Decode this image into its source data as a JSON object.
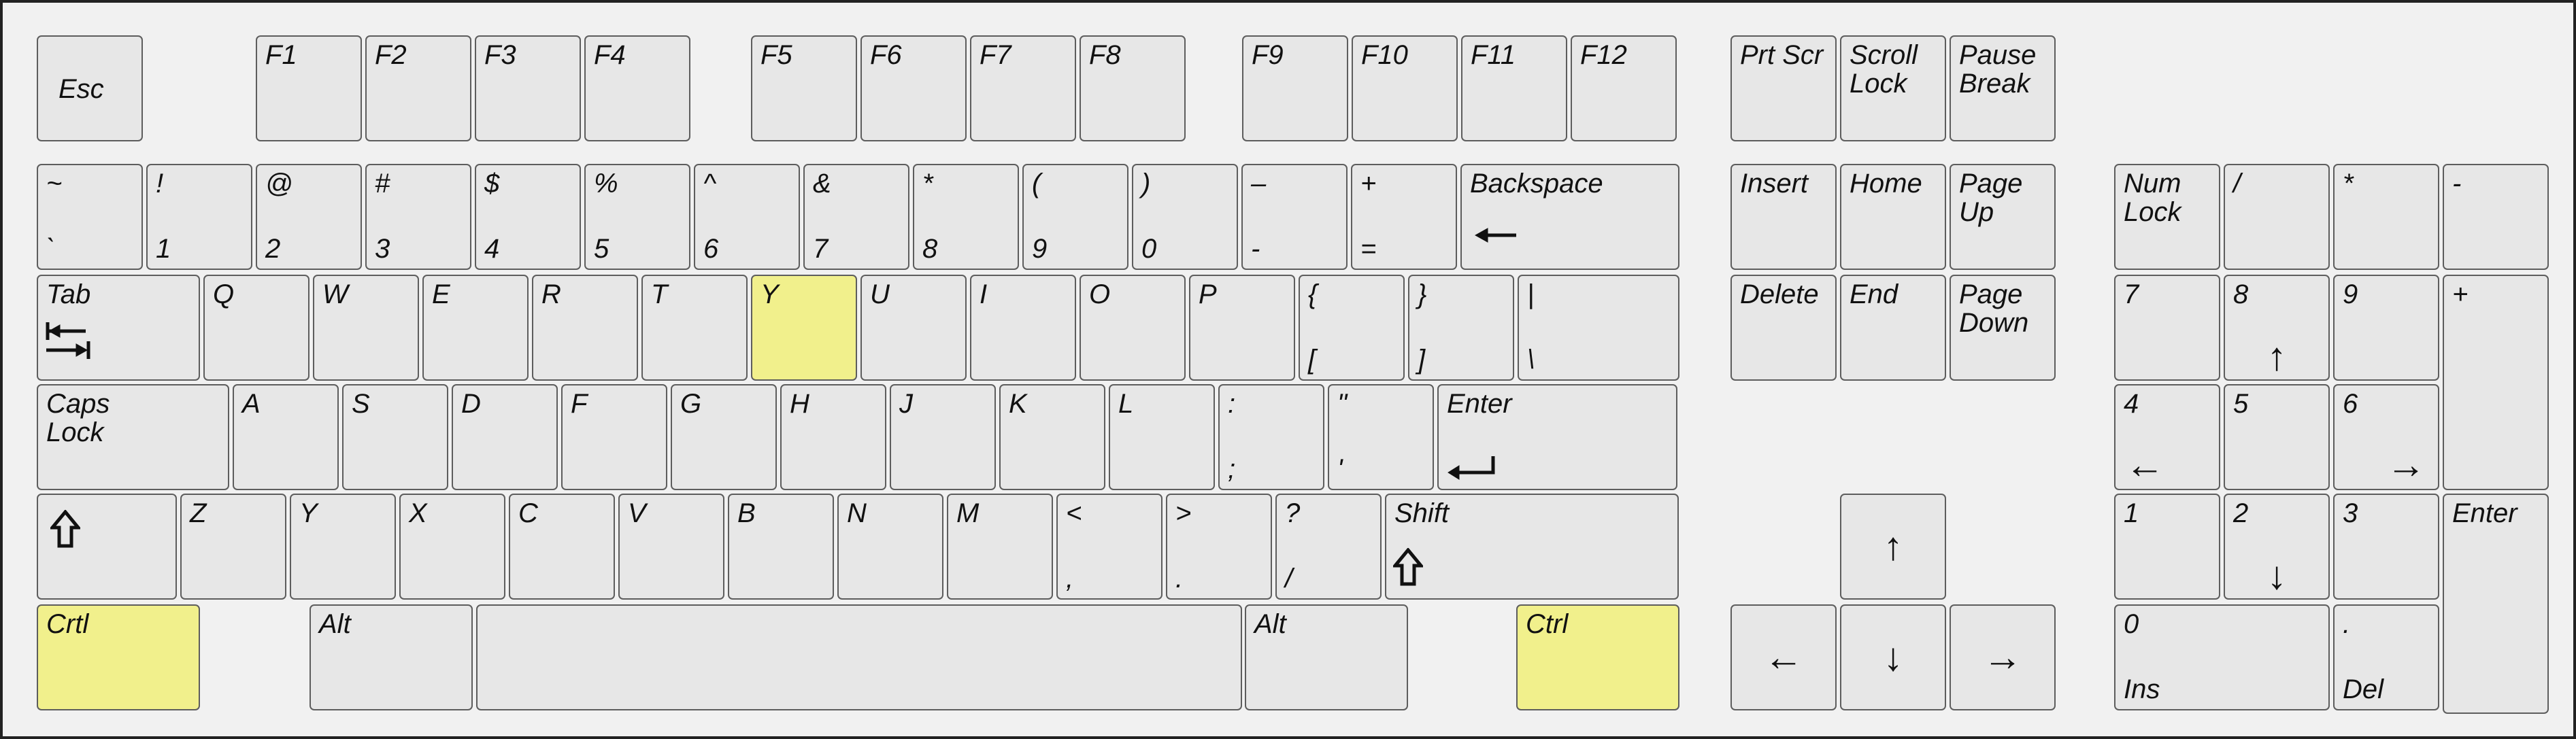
{
  "keyboard": {
    "highlight_color": "#f1f08c",
    "key_color": "#e7e7e7",
    "function_row": [
      {
        "name": "key-esc",
        "top": "Esc"
      },
      {
        "name": "key-f1",
        "top": "F1"
      },
      {
        "name": "key-f2",
        "top": "F2"
      },
      {
        "name": "key-f3",
        "top": "F3"
      },
      {
        "name": "key-f4",
        "top": "F4"
      },
      {
        "name": "key-f5",
        "top": "F5"
      },
      {
        "name": "key-f6",
        "top": "F6"
      },
      {
        "name": "key-f7",
        "top": "F7"
      },
      {
        "name": "key-f8",
        "top": "F8"
      },
      {
        "name": "key-f9",
        "top": "F9"
      },
      {
        "name": "key-f10",
        "top": "F10"
      },
      {
        "name": "key-f11",
        "top": "F11"
      },
      {
        "name": "key-f12",
        "top": "F12"
      },
      {
        "name": "key-prtscr",
        "top": "Prt Scr"
      },
      {
        "name": "key-scrolllock",
        "top": "Scroll\nLock"
      },
      {
        "name": "key-pausebreak",
        "top": "Pause\nBreak"
      }
    ],
    "number_row": [
      {
        "name": "key-backtick",
        "top": "~",
        "bottom": "`"
      },
      {
        "name": "key-1",
        "top": "!",
        "bottom": "1"
      },
      {
        "name": "key-2",
        "top": "@",
        "bottom": "2"
      },
      {
        "name": "key-3",
        "top": "#",
        "bottom": "3"
      },
      {
        "name": "key-4",
        "top": "$",
        "bottom": "4"
      },
      {
        "name": "key-5",
        "top": "%",
        "bottom": "5"
      },
      {
        "name": "key-6",
        "top": "^",
        "bottom": "6"
      },
      {
        "name": "key-7",
        "top": "&",
        "bottom": "7"
      },
      {
        "name": "key-8",
        "top": "*",
        "bottom": "8"
      },
      {
        "name": "key-9",
        "top": "(",
        "bottom": "9"
      },
      {
        "name": "key-0",
        "top": ")",
        "bottom": "0"
      },
      {
        "name": "key-minus",
        "top": "–",
        "bottom": "-"
      },
      {
        "name": "key-equals",
        "top": "+",
        "bottom": "="
      },
      {
        "name": "key-backspace",
        "top": "Backspace",
        "icon": "left-arrow-icon"
      }
    ],
    "top_row": [
      {
        "name": "key-tab",
        "top": "Tab",
        "icon": "tab-icon"
      },
      {
        "name": "key-q",
        "top": "Q"
      },
      {
        "name": "key-w",
        "top": "W"
      },
      {
        "name": "key-e",
        "top": "E"
      },
      {
        "name": "key-r",
        "top": "R"
      },
      {
        "name": "key-t",
        "top": "T"
      },
      {
        "name": "key-y",
        "top": "Y",
        "highlight": true
      },
      {
        "name": "key-u",
        "top": "U"
      },
      {
        "name": "key-i",
        "top": "I"
      },
      {
        "name": "key-o",
        "top": "O"
      },
      {
        "name": "key-p",
        "top": "P"
      },
      {
        "name": "key-lbracket",
        "top": "{",
        "bottom": "["
      },
      {
        "name": "key-rbracket",
        "top": "}",
        "bottom": "]"
      },
      {
        "name": "key-backslash",
        "top": "|",
        "bottom": "\\"
      }
    ],
    "home_row": [
      {
        "name": "key-capslock",
        "top": "Caps\nLock"
      },
      {
        "name": "key-a",
        "top": "A"
      },
      {
        "name": "key-s",
        "top": "S"
      },
      {
        "name": "key-d",
        "top": "D"
      },
      {
        "name": "key-f",
        "top": "F"
      },
      {
        "name": "key-g",
        "top": "G"
      },
      {
        "name": "key-h",
        "top": "H"
      },
      {
        "name": "key-j",
        "top": "J"
      },
      {
        "name": "key-k",
        "top": "K"
      },
      {
        "name": "key-l",
        "top": "L"
      },
      {
        "name": "key-semicolon",
        "top": ":",
        "bottom": ";"
      },
      {
        "name": "key-quote",
        "top": "\"",
        "bottom": "'"
      },
      {
        "name": "key-enter",
        "top": "Enter",
        "icon": "enter-icon"
      }
    ],
    "shift_row": [
      {
        "name": "key-lshift",
        "top": "",
        "icon": "shift-icon"
      },
      {
        "name": "key-z",
        "top": "Z"
      },
      {
        "name": "key-y2",
        "top": "Y"
      },
      {
        "name": "key-x",
        "top": "X"
      },
      {
        "name": "key-c",
        "top": "C"
      },
      {
        "name": "key-v",
        "top": "V"
      },
      {
        "name": "key-b",
        "top": "B"
      },
      {
        "name": "key-n",
        "top": "N"
      },
      {
        "name": "key-m",
        "top": "M"
      },
      {
        "name": "key-comma",
        "top": "<",
        "bottom": ","
      },
      {
        "name": "key-period",
        "top": ">",
        "bottom": "."
      },
      {
        "name": "key-slash",
        "top": "?",
        "bottom": "/"
      },
      {
        "name": "key-rshift",
        "top": "Shift",
        "icon": "shift-icon"
      }
    ],
    "bottom_row": [
      {
        "name": "key-lctrl",
        "top": "Crtl",
        "highlight": true
      },
      {
        "name": "key-lalt",
        "top": "Alt"
      },
      {
        "name": "key-space",
        "top": ""
      },
      {
        "name": "key-ralt",
        "top": "Alt"
      },
      {
        "name": "key-rctrl",
        "top": "Ctrl",
        "highlight": true
      }
    ],
    "nav_cluster": [
      {
        "name": "key-insert",
        "top": "Insert"
      },
      {
        "name": "key-home",
        "top": "Home"
      },
      {
        "name": "key-pageup",
        "top": "Page\nUp"
      },
      {
        "name": "key-delete",
        "top": "Delete"
      },
      {
        "name": "key-end",
        "top": "End"
      },
      {
        "name": "key-pagedown",
        "top": "Page\nDown"
      }
    ],
    "arrow_cluster": [
      {
        "name": "key-up",
        "icon": "up-arrow-icon",
        "glyph": "↑"
      },
      {
        "name": "key-left",
        "icon": "left-arrow-icon",
        "glyph": "←"
      },
      {
        "name": "key-down",
        "icon": "down-arrow-icon",
        "glyph": "↓"
      },
      {
        "name": "key-right",
        "icon": "right-arrow-icon",
        "glyph": "→"
      }
    ],
    "numpad": [
      {
        "name": "key-numlock",
        "top": "Num\nLock"
      },
      {
        "name": "key-num-divide",
        "top": "/"
      },
      {
        "name": "key-num-multiply",
        "top": "*"
      },
      {
        "name": "key-num-minus",
        "top": "-"
      },
      {
        "name": "key-num7",
        "top": "7"
      },
      {
        "name": "key-num8",
        "top": "8",
        "icon": "up-arrow-icon",
        "glyph": "↑"
      },
      {
        "name": "key-num9",
        "top": "9"
      },
      {
        "name": "key-num-plus",
        "top": "+"
      },
      {
        "name": "key-num4",
        "top": "4",
        "icon": "left-arrow-icon",
        "glyph": "←"
      },
      {
        "name": "key-num5",
        "top": "5"
      },
      {
        "name": "key-num6",
        "top": "6",
        "icon": "right-arrow-icon",
        "glyph": "→"
      },
      {
        "name": "key-num1",
        "top": "1"
      },
      {
        "name": "key-num2",
        "top": "2",
        "icon": "down-arrow-icon",
        "glyph": "↓"
      },
      {
        "name": "key-num3",
        "top": "3"
      },
      {
        "name": "key-num-enter",
        "top": "Enter"
      },
      {
        "name": "key-num0",
        "top": "0",
        "bottom": "Ins"
      },
      {
        "name": "key-num-decimal",
        "top": ".",
        "bottom": "Del"
      }
    ]
  }
}
